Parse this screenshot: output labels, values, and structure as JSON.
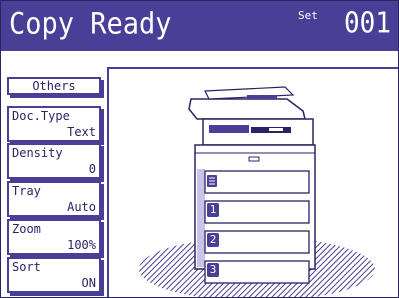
{
  "header": {
    "title": "Copy Ready",
    "set_label": "Set",
    "set_value": "001"
  },
  "sidebar": {
    "others_label": "Others",
    "buttons": [
      {
        "label": "Doc.Type",
        "value": "Text"
      },
      {
        "label": "Density",
        "value": "0"
      },
      {
        "label": "Tray",
        "value": "Auto"
      },
      {
        "label": "Zoom",
        "value": "100%"
      },
      {
        "label": "Sort",
        "value": "ON"
      }
    ]
  },
  "trays": [
    {
      "label": "1"
    },
    {
      "label": "2"
    },
    {
      "label": "3"
    }
  ],
  "colors": {
    "accent": "#4a3f96",
    "dark": "#2a2466",
    "background": "#ffffff"
  }
}
